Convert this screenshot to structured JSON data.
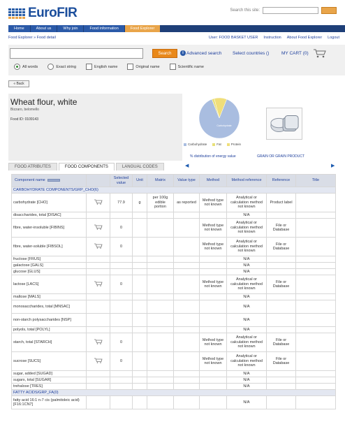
{
  "brand": {
    "logo_text": "EuroFIR"
  },
  "topsearch": {
    "label": "Search this site:"
  },
  "nav": {
    "tabs": [
      "Home",
      "About us",
      "Why join",
      "Food information",
      "Food Explorer"
    ]
  },
  "breadcrumb": "Food Explorer » Food detail",
  "userbar": {
    "user": "User: FOOD BASKET USER",
    "instruction": "Instruction",
    "about": "About Food Explorer",
    "logout": "Logout"
  },
  "search": {
    "button": "Search",
    "info": "i",
    "advanced": "Advanced search",
    "countries": "Select countries ()",
    "cart": "MY CART (0)",
    "options": [
      "All words",
      "Exact string",
      "English name",
      "Original name",
      "Scientific name"
    ]
  },
  "back_label": "« Back",
  "food": {
    "name": "Wheat flour, white",
    "subtitle": "Bizzaro, belomello",
    "id": "Food ID: 0109143"
  },
  "chart_data": {
    "type": "pie",
    "categories": [
      "Carbohydrate",
      "Fat",
      "Protein"
    ],
    "values": [
      88,
      2,
      10
    ],
    "colors": [
      "#a9bde0",
      "#e8e07a",
      "#f0de7a"
    ],
    "slice_label": "Carbohydrate",
    "caption": "% distribution of energy value"
  },
  "grain": {
    "caption": "GRAIN OR GRAIN PRODUCT"
  },
  "tabs": [
    "FOOD ATRIBUTES",
    "FOOD COMPONENTS",
    "LANGUAL CODES"
  ],
  "table": {
    "headers": [
      "Component name",
      "Selected value",
      "Unit",
      "Matrix",
      "Value type",
      "Method",
      "Method reference",
      "Reference",
      "Title"
    ],
    "rows": [
      {
        "kind": "group",
        "name": "CARBOHYDRATE COMPONENTS/GRP_CHO(6)"
      },
      {
        "kind": "tall",
        "name": "carbohydrate [CHO]",
        "cart": true,
        "value": "77.9",
        "unit": "g",
        "matrix": "per 100g edible portion",
        "vtype": "as reported",
        "method": "Method type not known",
        "mref": "Analytical or calculation method not known",
        "ref": "Product label",
        "title": ""
      },
      {
        "kind": "plain",
        "name": "disaccharides, total [DISAC]",
        "mref": "N/A"
      },
      {
        "kind": "tall",
        "name": "fibre, water-insoluble [FIBINS]",
        "cart": true,
        "value": "0",
        "method": "Method type not known",
        "mref": "Analytical or calculation method not known",
        "ref": "File or Database"
      },
      {
        "kind": "tall",
        "name": "fibre, water-soluble [FIBSOL]",
        "cart": true,
        "value": "0",
        "method": "Method type not known",
        "mref": "Analytical or calculation method not known",
        "ref": "File or Database"
      },
      {
        "kind": "plain",
        "name": "fructose [FRUS]",
        "mref": "N/A"
      },
      {
        "kind": "plain",
        "name": "galactose [GALS]",
        "mref": "N/A"
      },
      {
        "kind": "plain",
        "name": "glucose [GLUS]",
        "mref": "N/A"
      },
      {
        "kind": "tall",
        "name": "lactose [LACS]",
        "cart": true,
        "value": "0",
        "method": "Method type not known",
        "mref": "Analytical or calculation method not known",
        "ref": "File or Database"
      },
      {
        "kind": "plain",
        "name": "maltose [MALS]",
        "mref": "N/A"
      },
      {
        "kind": "mid",
        "name": "monosaccharides, total [MNSAC]",
        "mref": "N/A"
      },
      {
        "kind": "mid",
        "name": "non-starch polysaccharides [NSP]",
        "mref": "N/A"
      },
      {
        "kind": "plain",
        "name": "polyols, total [POLYL]",
        "mref": "N/A"
      },
      {
        "kind": "tall",
        "name": "starch, total [STARCH]",
        "cart": true,
        "value": "0",
        "method": "Method type not known",
        "mref": "Analytical or calculation method not known",
        "ref": "File or Database"
      },
      {
        "kind": "tall",
        "name": "sucrose [SUCS]",
        "cart": true,
        "value": "0",
        "method": "Method type not known",
        "mref": "Analytical or calculation method not known",
        "ref": "File or Database"
      },
      {
        "kind": "plain",
        "name": "sugar, added [SUGAD]",
        "mref": "N/A"
      },
      {
        "kind": "plain",
        "name": "sugars, total [SUGAR]",
        "mref": "N/A"
      },
      {
        "kind": "plain",
        "name": "trehalose [TRES]",
        "mref": "N/A"
      },
      {
        "kind": "group",
        "name": "FATTY ACIDS/GRP_FA(0)"
      },
      {
        "kind": "mid",
        "name": "fatty acid 16:1 n-7 cis (palmitoleic acid) [F16:1CN7]",
        "mref": "N/A"
      }
    ]
  },
  "colors": {
    "nav": "#1e3f78",
    "accent": "#e9a54a",
    "link": "#1e3f9c"
  }
}
